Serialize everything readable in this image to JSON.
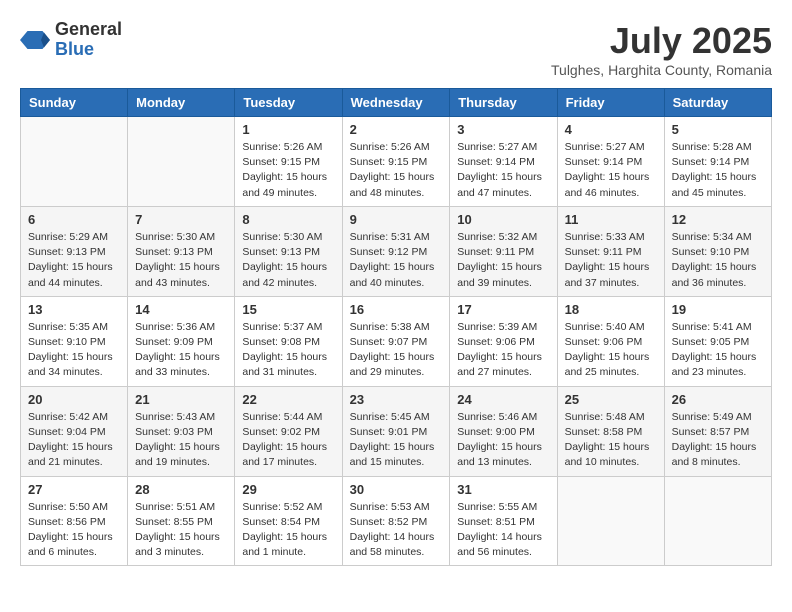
{
  "header": {
    "logo_general": "General",
    "logo_blue": "Blue",
    "month_year": "July 2025",
    "location": "Tulghes, Harghita County, Romania"
  },
  "weekdays": [
    "Sunday",
    "Monday",
    "Tuesday",
    "Wednesday",
    "Thursday",
    "Friday",
    "Saturday"
  ],
  "weeks": [
    [
      {
        "day": "",
        "info": ""
      },
      {
        "day": "",
        "info": ""
      },
      {
        "day": "1",
        "info": "Sunrise: 5:26 AM\nSunset: 9:15 PM\nDaylight: 15 hours\nand 49 minutes."
      },
      {
        "day": "2",
        "info": "Sunrise: 5:26 AM\nSunset: 9:15 PM\nDaylight: 15 hours\nand 48 minutes."
      },
      {
        "day": "3",
        "info": "Sunrise: 5:27 AM\nSunset: 9:14 PM\nDaylight: 15 hours\nand 47 minutes."
      },
      {
        "day": "4",
        "info": "Sunrise: 5:27 AM\nSunset: 9:14 PM\nDaylight: 15 hours\nand 46 minutes."
      },
      {
        "day": "5",
        "info": "Sunrise: 5:28 AM\nSunset: 9:14 PM\nDaylight: 15 hours\nand 45 minutes."
      }
    ],
    [
      {
        "day": "6",
        "info": "Sunrise: 5:29 AM\nSunset: 9:13 PM\nDaylight: 15 hours\nand 44 minutes."
      },
      {
        "day": "7",
        "info": "Sunrise: 5:30 AM\nSunset: 9:13 PM\nDaylight: 15 hours\nand 43 minutes."
      },
      {
        "day": "8",
        "info": "Sunrise: 5:30 AM\nSunset: 9:13 PM\nDaylight: 15 hours\nand 42 minutes."
      },
      {
        "day": "9",
        "info": "Sunrise: 5:31 AM\nSunset: 9:12 PM\nDaylight: 15 hours\nand 40 minutes."
      },
      {
        "day": "10",
        "info": "Sunrise: 5:32 AM\nSunset: 9:11 PM\nDaylight: 15 hours\nand 39 minutes."
      },
      {
        "day": "11",
        "info": "Sunrise: 5:33 AM\nSunset: 9:11 PM\nDaylight: 15 hours\nand 37 minutes."
      },
      {
        "day": "12",
        "info": "Sunrise: 5:34 AM\nSunset: 9:10 PM\nDaylight: 15 hours\nand 36 minutes."
      }
    ],
    [
      {
        "day": "13",
        "info": "Sunrise: 5:35 AM\nSunset: 9:10 PM\nDaylight: 15 hours\nand 34 minutes."
      },
      {
        "day": "14",
        "info": "Sunrise: 5:36 AM\nSunset: 9:09 PM\nDaylight: 15 hours\nand 33 minutes."
      },
      {
        "day": "15",
        "info": "Sunrise: 5:37 AM\nSunset: 9:08 PM\nDaylight: 15 hours\nand 31 minutes."
      },
      {
        "day": "16",
        "info": "Sunrise: 5:38 AM\nSunset: 9:07 PM\nDaylight: 15 hours\nand 29 minutes."
      },
      {
        "day": "17",
        "info": "Sunrise: 5:39 AM\nSunset: 9:06 PM\nDaylight: 15 hours\nand 27 minutes."
      },
      {
        "day": "18",
        "info": "Sunrise: 5:40 AM\nSunset: 9:06 PM\nDaylight: 15 hours\nand 25 minutes."
      },
      {
        "day": "19",
        "info": "Sunrise: 5:41 AM\nSunset: 9:05 PM\nDaylight: 15 hours\nand 23 minutes."
      }
    ],
    [
      {
        "day": "20",
        "info": "Sunrise: 5:42 AM\nSunset: 9:04 PM\nDaylight: 15 hours\nand 21 minutes."
      },
      {
        "day": "21",
        "info": "Sunrise: 5:43 AM\nSunset: 9:03 PM\nDaylight: 15 hours\nand 19 minutes."
      },
      {
        "day": "22",
        "info": "Sunrise: 5:44 AM\nSunset: 9:02 PM\nDaylight: 15 hours\nand 17 minutes."
      },
      {
        "day": "23",
        "info": "Sunrise: 5:45 AM\nSunset: 9:01 PM\nDaylight: 15 hours\nand 15 minutes."
      },
      {
        "day": "24",
        "info": "Sunrise: 5:46 AM\nSunset: 9:00 PM\nDaylight: 15 hours\nand 13 minutes."
      },
      {
        "day": "25",
        "info": "Sunrise: 5:48 AM\nSunset: 8:58 PM\nDaylight: 15 hours\nand 10 minutes."
      },
      {
        "day": "26",
        "info": "Sunrise: 5:49 AM\nSunset: 8:57 PM\nDaylight: 15 hours\nand 8 minutes."
      }
    ],
    [
      {
        "day": "27",
        "info": "Sunrise: 5:50 AM\nSunset: 8:56 PM\nDaylight: 15 hours\nand 6 minutes."
      },
      {
        "day": "28",
        "info": "Sunrise: 5:51 AM\nSunset: 8:55 PM\nDaylight: 15 hours\nand 3 minutes."
      },
      {
        "day": "29",
        "info": "Sunrise: 5:52 AM\nSunset: 8:54 PM\nDaylight: 15 hours\nand 1 minute."
      },
      {
        "day": "30",
        "info": "Sunrise: 5:53 AM\nSunset: 8:52 PM\nDaylight: 14 hours\nand 58 minutes."
      },
      {
        "day": "31",
        "info": "Sunrise: 5:55 AM\nSunset: 8:51 PM\nDaylight: 14 hours\nand 56 minutes."
      },
      {
        "day": "",
        "info": ""
      },
      {
        "day": "",
        "info": ""
      }
    ]
  ]
}
